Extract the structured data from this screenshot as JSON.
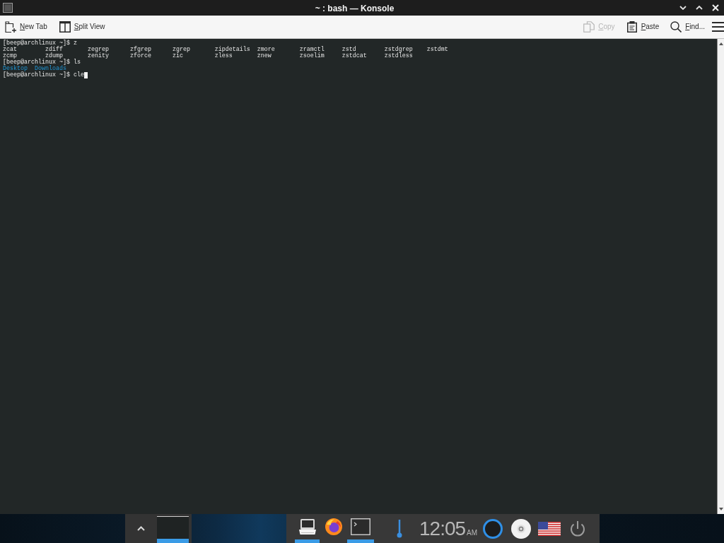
{
  "window": {
    "title": "~ : bash — Konsole"
  },
  "toolbar": {
    "left": [
      {
        "kind": "newtab",
        "label": "New Tab",
        "disabled": false
      },
      {
        "kind": "split",
        "label": "Split View",
        "disabled": false
      }
    ],
    "right": [
      {
        "kind": "copy",
        "label": "Copy",
        "disabled": true
      },
      {
        "kind": "paste",
        "label": "Paste",
        "disabled": false
      },
      {
        "kind": "find",
        "label": "Find...",
        "disabled": false
      }
    ]
  },
  "terminal": {
    "lines": [
      {
        "kind": "prompt",
        "text": "[beep@archlinux ~]$ z",
        "cursor": false
      },
      {
        "kind": "output",
        "text": "zcat        zdiff       zegrep      zfgrep      zgrep       zipdetails  zmore       zramctl     zstd        zstdgrep    zstdmt",
        "cursor": false
      },
      {
        "kind": "output",
        "text": "zcmp        zdump       zenity      zforce      zic         zless       znew        zsoelim     zstdcat     zstdless",
        "cursor": false
      },
      {
        "kind": "prompt",
        "text": "[beep@archlinux ~]$ ls",
        "cursor": false
      },
      {
        "kind": "directory",
        "text": "Desktop  Downloads",
        "cursor": false
      },
      {
        "kind": "prompt",
        "text": "[beep@archlinux ~]$ cle",
        "cursor": true
      }
    ]
  },
  "taskbar": {
    "window_thumbnail": {
      "active": true
    },
    "launchers": [
      {
        "kind": "computer",
        "running": true
      },
      {
        "kind": "browser",
        "running": false
      },
      {
        "kind": "terminal",
        "running": true
      }
    ],
    "clock": {
      "time": "12:05",
      "period": "AM"
    }
  }
}
